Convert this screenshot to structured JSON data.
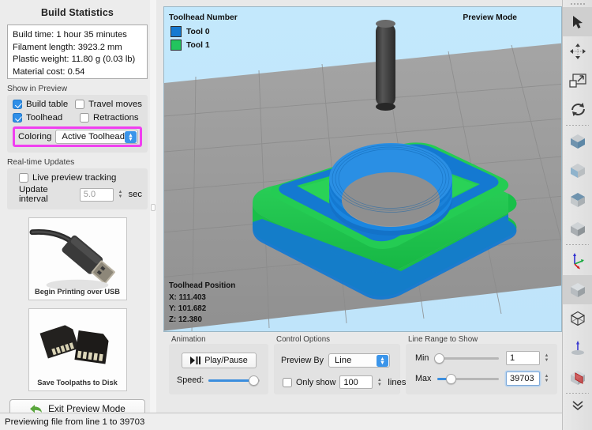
{
  "left_panel": {
    "title": "Build Statistics",
    "stats": [
      "Build time: 1 hour 35 minutes",
      "Filament length: 3923.2 mm",
      "Plastic weight: 11.80 g (0.03 lb)",
      "Material cost: 0.54"
    ],
    "show_in_preview": {
      "label": "Show in Preview",
      "checkboxes": [
        {
          "label": "Build table",
          "checked": true
        },
        {
          "label": "Travel moves",
          "checked": false
        },
        {
          "label": "Toolhead",
          "checked": true
        },
        {
          "label": "Retractions",
          "checked": false
        }
      ],
      "coloring_label": "Coloring",
      "coloring_value": "Active Toolhead",
      "highlight_color": "#f03ff0"
    },
    "realtime": {
      "label": "Real-time Updates",
      "live_preview_label": "Live preview tracking",
      "live_preview_checked": false,
      "interval_label": "Update interval",
      "interval_value": "5.0",
      "interval_unit": "sec"
    },
    "usb_button_caption": "Begin Printing over USB",
    "sd_button_caption": "Save Toolpaths to Disk",
    "exit_button_label": "Exit Preview Mode"
  },
  "viewport": {
    "legend_title": "Toolhead Number",
    "preview_mode_label": "Preview Mode",
    "legend": [
      {
        "label": "Tool 0",
        "color": "#1479d1"
      },
      {
        "label": "Tool 1",
        "color": "#22c55e"
      }
    ],
    "toolhead_position": {
      "header": "Toolhead Position",
      "x": "X: 111.403",
      "y": "Y: 101.682",
      "z": "Z: 12.380"
    },
    "background_color": "#bfe6fb",
    "build_plate_color": "#9b9b9b"
  },
  "controls": {
    "animation": {
      "group_label": "Animation",
      "play_label": "Play/Pause",
      "speed_label": "Speed:",
      "speed_percent": 88
    },
    "control_options": {
      "group_label": "Control Options",
      "preview_by_label": "Preview By",
      "preview_by_value": "Line",
      "only_show_label": "Only show",
      "only_show_checked": false,
      "only_show_value": "100",
      "lines_label": "lines"
    },
    "line_range": {
      "group_label": "Line Range to Show",
      "min_label": "Min",
      "min_value": "1",
      "min_percent": 3,
      "max_label": "Max",
      "max_value": "39703",
      "max_percent": 22
    }
  },
  "status_bar": {
    "text": "Previewing file from line 1 to 39703"
  },
  "toolbar": {
    "items": [
      {
        "name": "select-arrow-icon",
        "selected": true
      },
      {
        "name": "move-icon",
        "selected": false
      },
      {
        "name": "scale-icon",
        "selected": false
      },
      {
        "name": "rotate-icon",
        "selected": false
      },
      {
        "name": "view-front-icon",
        "selected": false
      },
      {
        "name": "view-left-icon",
        "selected": false
      },
      {
        "name": "view-top-icon",
        "selected": false
      },
      {
        "name": "view-iso-icon",
        "selected": false
      },
      {
        "name": "axes-icon",
        "selected": false
      },
      {
        "name": "view-home-icon",
        "selected": true
      },
      {
        "name": "wireframe-icon",
        "selected": false
      },
      {
        "name": "lay-flat-icon",
        "selected": false
      },
      {
        "name": "cross-section-icon",
        "selected": false
      },
      {
        "name": "more-chevrons-icon",
        "selected": false
      }
    ]
  }
}
